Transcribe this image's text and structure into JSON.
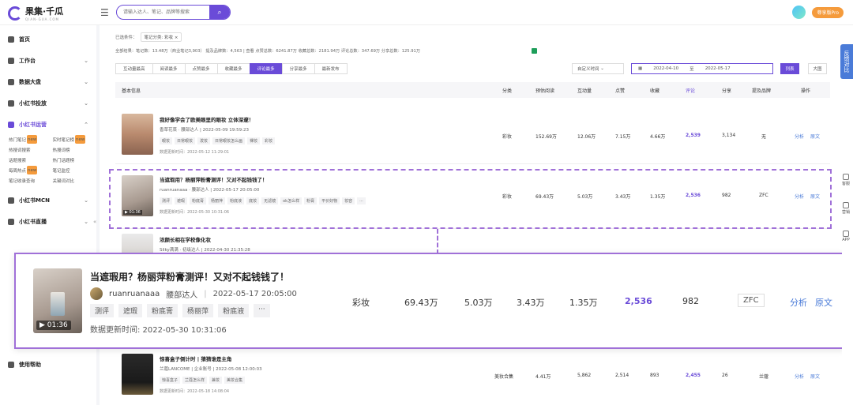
{
  "app": {
    "logo_title": "果集·千瓜",
    "logo_sub": "QIAN-GUA.COM",
    "search_placeholder": "请输入达人、笔记、品牌等搜索",
    "pro_label": "尊享版Pro"
  },
  "sidebar": {
    "items": [
      {
        "label": "首页"
      },
      {
        "label": "工作台"
      },
      {
        "label": "数据大盘"
      },
      {
        "label": "小红书投放"
      },
      {
        "label": "小红书运营"
      }
    ],
    "subnav": [
      "热门笔记",
      "实时笔记榜",
      "热搜词搜索",
      "热搜词榜",
      "话题搜索",
      "热门话题榜",
      "每周热点",
      "笔记监控",
      "笔记收录查询",
      "关键词对比"
    ],
    "items_after": [
      {
        "label": "小红书MCN"
      },
      {
        "label": "小红书直播"
      }
    ],
    "help": "使用帮助"
  },
  "filters": {
    "selected_label": "已选条件：",
    "selected_chip": "笔记分类: 彩妆",
    "summary": "全部结果：笔记数：13.48万（商业笔记3,903）  提及品牌数：4,563 | 查看  点赞总数：6241.87万  收藏总数：2181.94万  评论总数：347.69万  分享总数：125.91万"
  },
  "tabs": [
    "互动量最高",
    "阅读最多",
    "点赞最多",
    "收藏最多",
    "评论最多",
    "分享最多",
    "最新发布"
  ],
  "active_tab": 4,
  "date": {
    "mode": "自定义时间",
    "start": "2022-04-10",
    "sep": "至",
    "end": "2022-05-17"
  },
  "view": {
    "list": "列表",
    "grid": "大图"
  },
  "columns": [
    "基本信息",
    "分类",
    "预估阅读",
    "互动量",
    "点赞",
    "收藏",
    "评论",
    "分享",
    "提及品牌",
    "操作"
  ],
  "rows": [
    {
      "title": "我好像学会了欧美眼里的眼妆 立体深邃！",
      "author": "香草花菜 · 腰部达人 | 2022-05-09 19:59:23",
      "tags": [
        "眼妆",
        "日常眼妆",
        "泼妆",
        "日常眼妆怎么画",
        "裸妆",
        "彩妆"
      ],
      "updated": "数据更新时间：2022-05-12 11:29:01",
      "category": "彩妆",
      "read": "152.69万",
      "interact": "12.06万",
      "likes": "7.15万",
      "collect": "4.66万",
      "comments": "2,539",
      "shares": "3,134",
      "brand": "无",
      "op1": "分析",
      "op2": "原文"
    },
    {
      "title": "当遮瑕用？杨丽萍粉膏测评！又对不起钱钱了！",
      "author": "ruanruanaaa · 腰部达人 | 2022-05-17 20:05:00",
      "duration": "01:36",
      "tags": [
        "测评",
        "遮瑕",
        "粉底膏",
        "杨丽萍",
        "粉底液",
        "底妆",
        "无滤镜",
        "ok怎么样",
        "粉膏",
        "平价好物",
        "妆容",
        "..."
      ],
      "updated": "数据更新时间：2022-05-30 10:31:06",
      "category": "彩妆",
      "read": "69.43万",
      "interact": "5.03万",
      "likes": "3.43万",
      "collect": "1.35万",
      "comments": "2,536",
      "shares": "982",
      "brand": "ZFC",
      "op1": "分析",
      "op2": "原文"
    },
    {
      "title": "浓颜长相在学校像化妆",
      "author": "Silky满满 · 初级达人 | 2022-04-30 21:35:28"
    },
    {
      "title": "惊喜盒子倒计时 | 猜猜谁是主角",
      "author": "兰蔻LANCOME | 企业账号 | 2022-05-08 12:00:03",
      "tags": [
        "惊喜盒子",
        "兰蔻怎么样",
        "兼妆",
        "美妆合集"
      ],
      "updated": "数据更新时间：2022-05-18 14:08:04",
      "category": "美妆合集",
      "read": "4.41万",
      "interact": "5,862",
      "likes": "2,514",
      "collect": "893",
      "comments": "2,455",
      "shares": "26",
      "brand": "兰蔻",
      "op1": "分析",
      "op2": "原文"
    }
  ],
  "zoom": {
    "title": "当遮瑕用？杨丽萍粉膏测评！又对不起钱钱了！",
    "author": "ruanruanaaa",
    "level": "腰部达人",
    "published": "2022-05-17 20:05:00",
    "duration": "01:36",
    "tags": [
      "测评",
      "遮瑕",
      "粉底膏",
      "杨丽萍",
      "粉底液",
      "···"
    ],
    "updated": "数据更新时间:  2022-05-30 10:31:06",
    "category": "彩妆",
    "read": "69.43万",
    "interact": "5.03万",
    "likes": "3.43万",
    "collect": "1.35万",
    "comments": "2,536",
    "shares": "982",
    "brand": "ZFC",
    "op1": "分析",
    "op2": "原文"
  },
  "float": {
    "feedback": "反馈对比",
    "service": "客服",
    "sales": "营销",
    "app": "APP"
  },
  "colors": {
    "accent": "#6a4bd8",
    "link": "#4a7bd8",
    "highlight_border": "#a070d8",
    "pro": "#f59b3c"
  }
}
